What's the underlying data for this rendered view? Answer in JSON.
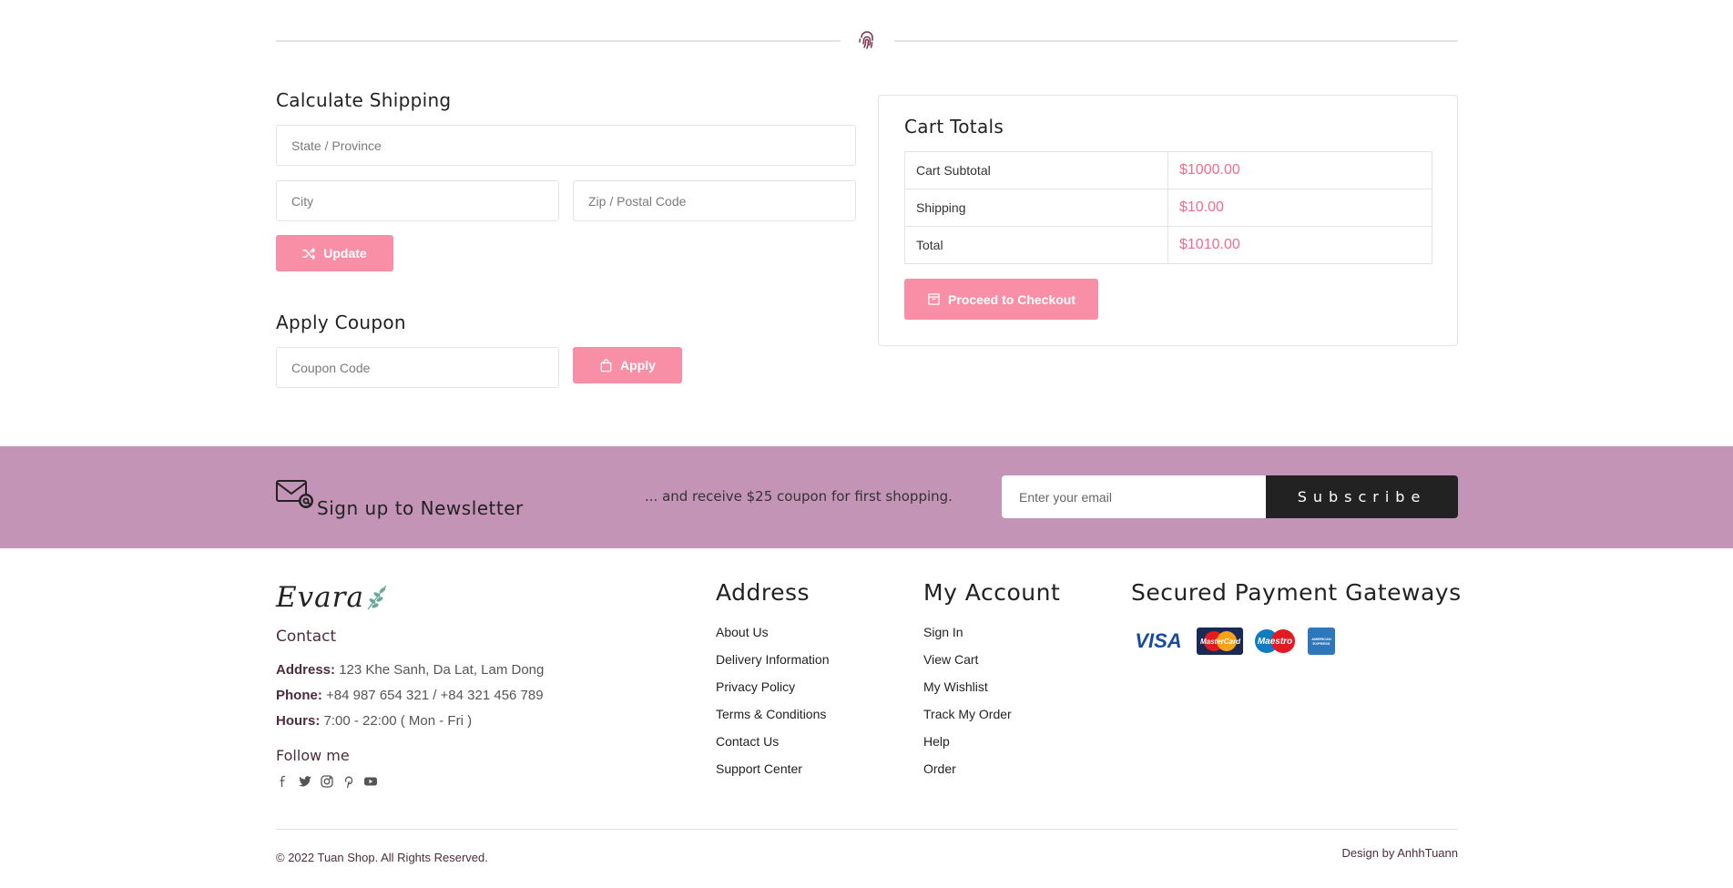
{
  "shipping": {
    "title": "Calculate Shipping",
    "state_placeholder": "State / Province",
    "city_placeholder": "City",
    "zip_placeholder": "Zip / Postal Code",
    "update_label": "Update"
  },
  "coupon": {
    "title": "Apply Coupon",
    "code_placeholder": "Coupon Code",
    "apply_label": "Apply"
  },
  "totals": {
    "title": "Cart Totals",
    "rows": [
      {
        "label": "Cart Subtotal",
        "value": "$1000.00"
      },
      {
        "label": "Shipping",
        "value": "$10.00"
      },
      {
        "label": "Total",
        "value": "$1010.00"
      }
    ],
    "checkout_label": "Proceed to Checkout"
  },
  "newsletter": {
    "title": "Sign up to Newsletter",
    "tagline": "... and receive $25 coupon for first shopping.",
    "email_placeholder": "Enter your email",
    "subscribe_label": "Subscribe"
  },
  "footer": {
    "logo_text": "Evara",
    "contact_title": "Contact",
    "address_label": "Address:",
    "address_value": "123 Khe Sanh, Da Lat, Lam Dong",
    "phone_label": "Phone:",
    "phone_value": "+84 987 654 321 / +84 321 456 789",
    "hours_label": "Hours:",
    "hours_value": "7:00 - 22:00 ( Mon - Fri )",
    "follow_title": "Follow me",
    "social_icons": [
      "facebook-icon",
      "twitter-icon",
      "instagram-icon",
      "pinterest-icon",
      "youtube-icon"
    ],
    "address_col": {
      "title": "Address",
      "links": [
        "About Us",
        "Delivery Information",
        "Privacy Policy",
        "Terms & Conditions",
        "Contact Us",
        "Support Center"
      ]
    },
    "account_col": {
      "title": "My Account",
      "links": [
        "Sign In",
        "View Cart",
        "My Wishlist",
        "Track My Order",
        "Help",
        "Order"
      ]
    },
    "payment_col": {
      "title": "Secured Payment Gateways",
      "cards": [
        "VISA",
        "MasterCard",
        "Maestro",
        "AMERICAN EXPRESS"
      ]
    },
    "copyright": "© 2022 Tuan Shop. All Rights Reserved.",
    "credit": "Design by AnhhTuann"
  },
  "colors": {
    "accent_pink": "#f98fa6",
    "price_pink": "#f46b8b",
    "newsletter_bg": "#c394b5",
    "dark": "#222222"
  }
}
